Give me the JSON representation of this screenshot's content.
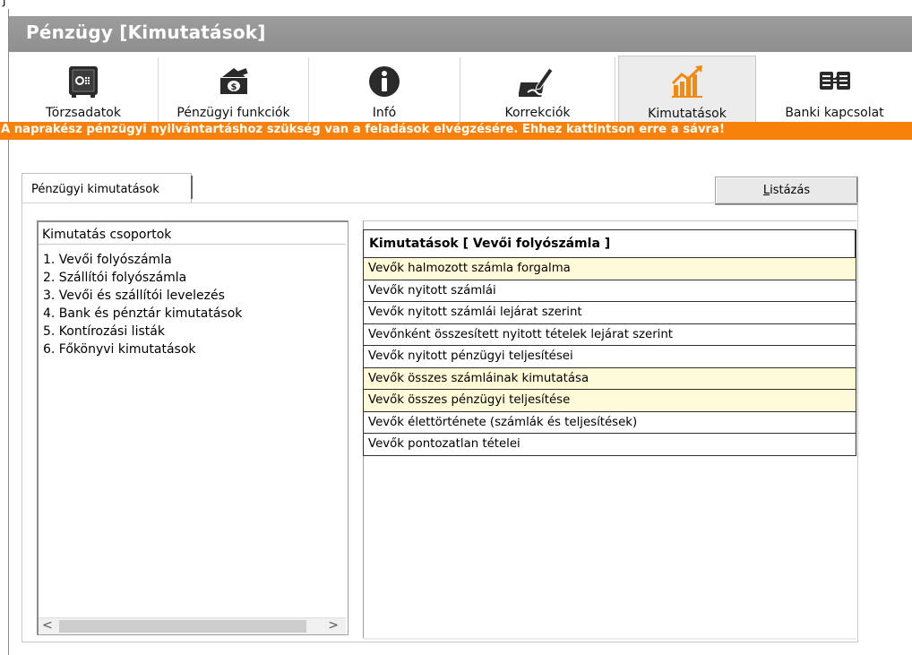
{
  "window": {
    "title": "Pénzügy [Kimutatások]"
  },
  "toolbar": {
    "items": [
      {
        "label": "Törzsadatok",
        "icon": "safe-icon"
      },
      {
        "label": "Pénzügyi funkciók",
        "icon": "money-icon"
      },
      {
        "label": "Infó",
        "icon": "info-icon"
      },
      {
        "label": "Korrekciók",
        "icon": "edit-icon"
      },
      {
        "label": "Kimutatások",
        "icon": "chart-icon",
        "active": true
      },
      {
        "label": "Banki kapcsolat",
        "icon": "bank-transfer-icon"
      }
    ]
  },
  "banner": {
    "text": "A naprakész pénzügyi nyilvántartáshoz szükség van a feladások elvégzésére. Ehhez kattintson erre a sávra!"
  },
  "tab": {
    "label": "Pénzügyi kimutatások"
  },
  "actions": {
    "list_button": {
      "label_prefix": "",
      "label_underlined": "L",
      "label_rest": "istázás"
    }
  },
  "groups": {
    "header": "Kimutatás csoportok",
    "items": [
      "1. Vevői folyószámla",
      "2. Szállítói folyószámla",
      "3. Vevői és szállítói levelezés",
      "4. Bank és pénztár kimutatások",
      "5. Kontírozási listák",
      "6. Főkönyvi kimutatások"
    ]
  },
  "reports": {
    "header": "Kimutatások [ Vevői folyószámla ]",
    "rows": [
      {
        "label": "Vevők halmozott számla forgalma",
        "highlight": true
      },
      {
        "label": "Vevők nyitott számlái",
        "highlight": false
      },
      {
        "label": "Vevők nyitott számlái lejárat szerint",
        "highlight": false
      },
      {
        "label": "Vevőnként összesített nyitott tételek lejárat szerint",
        "highlight": false
      },
      {
        "label": "Vevők nyitott pénzügyi teljesítései",
        "highlight": false
      },
      {
        "label": "Vevők összes számláinak kimutatása",
        "highlight": true
      },
      {
        "label": "Vevők összes pénzügyi teljesítése",
        "highlight": true
      },
      {
        "label": "Vevők élettörténete (számlák és teljesítések)",
        "highlight": false
      },
      {
        "label": "Vevők pontozatlan tételei",
        "highlight": false
      }
    ]
  },
  "colors": {
    "banner": "#f7810a",
    "titlebar": "#959595",
    "row_highlight": "#fffbd9"
  }
}
